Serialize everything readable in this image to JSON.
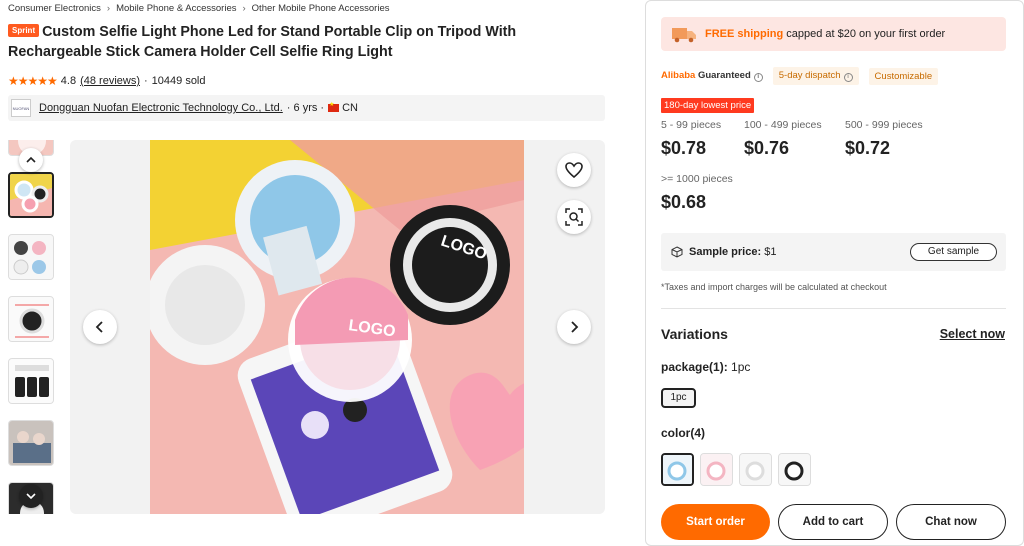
{
  "breadcrumb": [
    "Consumer Electronics",
    "Mobile Phone & Accessories",
    "Other Mobile Phone Accessories"
  ],
  "breadcrumb_separator": "›",
  "product": {
    "badge": "Sprint",
    "title": "Custom Selfie Light Phone Led for Stand Portable Clip on Tripod With Rechargeable Stick Camera Holder Cell Selfie Ring Light",
    "rating": "4.8",
    "reviews": "(48 reviews)",
    "sold": "10449 sold",
    "star_count": 5
  },
  "supplier": {
    "logo_text": "NUOFAN",
    "name": "Dongguan Nuofan Electronic Technology Co., Ltd.",
    "years": "· 6 yrs ·",
    "country": "CN"
  },
  "gallery": {
    "thumb_count": 6,
    "active_thumb": 1
  },
  "promo": {
    "free_shipping": "FREE shipping",
    "shipping_text": "capped at $20 on your first order"
  },
  "badges": {
    "guarantee_brand": "Alibaba",
    "guarantee_word": "Guaranteed",
    "dispatch": "5-day dispatch",
    "customizable": "Customizable"
  },
  "lowest_price_tag": "180-day lowest price",
  "tiers": [
    {
      "qty": "5 - 99 pieces",
      "price": "$0.78"
    },
    {
      "qty": "100 - 499 pieces",
      "price": "$0.76"
    },
    {
      "qty": "500 - 999 pieces",
      "price": "$0.72"
    },
    {
      "qty": ">= 1000 pieces",
      "price": "$0.68"
    }
  ],
  "sample": {
    "label": "Sample price:",
    "price": "$1",
    "button": "Get sample"
  },
  "tax_note": "*Taxes and import charges will be calculated at checkout",
  "variations": {
    "title": "Variations",
    "select_now": "Select now",
    "package_label": "package(1):",
    "package_value": "1pc",
    "package_option": "1pc",
    "color_label": "color(4)"
  },
  "actions": {
    "start_order": "Start order",
    "add_to_cart": "Add to cart",
    "chat_now": "Chat now"
  },
  "colors": {
    "accent": "#ff6a00",
    "promo_bg": "#fde6e2",
    "lowest_tag": "#ff3a1f"
  }
}
